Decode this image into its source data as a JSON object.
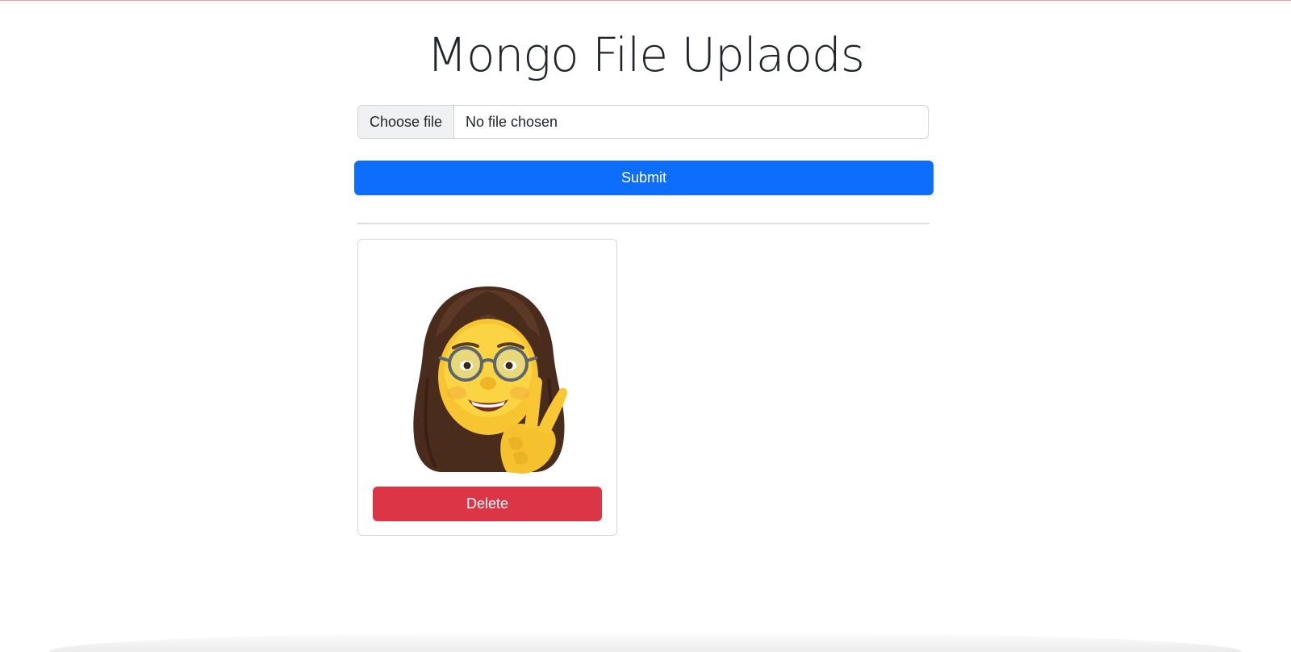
{
  "page": {
    "title": "Mongo File Uplaods"
  },
  "upload_form": {
    "choose_file_label": "Choose file",
    "file_status": "No file chosen",
    "submit_label": "Submit"
  },
  "files": [
    {
      "image": "memoji-peace-sign",
      "delete_label": "Delete"
    }
  ],
  "colors": {
    "primary": "#0d6efd",
    "danger": "#dc3545",
    "border": "#ced4da"
  }
}
